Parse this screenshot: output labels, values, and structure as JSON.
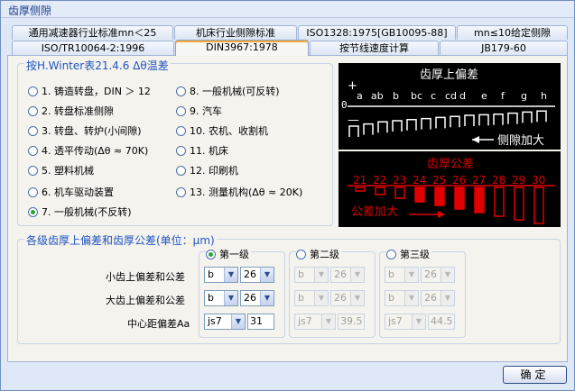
{
  "window": {
    "title": "齿厚侧隙"
  },
  "tabs_row1": [
    {
      "label": "通用减速器行业标准mn＜25"
    },
    {
      "label": "机床行业侧隙标准"
    },
    {
      "label": "ISO1328:1975[GB10095-88]"
    },
    {
      "label": "mn≤10给定侧隙"
    }
  ],
  "tabs_row2": [
    {
      "label": "ISO/TR10064-2:1996"
    },
    {
      "label": "DIN3967:1978"
    },
    {
      "label": "按节线速度计算"
    },
    {
      "label": "JB179-60"
    }
  ],
  "winter_group": {
    "title": "按H.Winter表21.4.6 Δθ温差",
    "options": [
      {
        "label": "1. 铸造转盘，DIN ＞ 12"
      },
      {
        "label": "2. 转盘标准侧隙"
      },
      {
        "label": "3. 转盘、转炉(小间隙)"
      },
      {
        "label": "4. 透平传动(Δθ ≈ 70K)"
      },
      {
        "label": "5. 塑料机械"
      },
      {
        "label": "6. 机车驱动装置"
      },
      {
        "label": "7. 一般机械(不反转)"
      },
      {
        "label": "8. 一般机械(可反转)"
      },
      {
        "label": "9. 汽车"
      },
      {
        "label": "10. 农机、收割机"
      },
      {
        "label": "11. 机床"
      },
      {
        "label": "12. 印刷机"
      },
      {
        "label": "13. 测量机构(Δθ ≈ 20K)"
      }
    ],
    "selected_index": 6
  },
  "diagram_upper": {
    "title": "齿厚上偏差",
    "plus": "+",
    "minus": "—",
    "zero": "0",
    "letters": [
      "a",
      "ab",
      "b",
      "bc",
      "c",
      "cd",
      "d",
      "e",
      "f",
      "g",
      "h"
    ],
    "arrow_label": "侧隙加大"
  },
  "diagram_lower": {
    "title": "齿厚公差",
    "numbers": [
      "21",
      "22",
      "23",
      "24",
      "25",
      "26",
      "27",
      "28",
      "29",
      "30"
    ],
    "arrow_label": "公差加大"
  },
  "grades_group": {
    "title": "各级齿厚上偏差和齿厚公差(单位：μm)",
    "grade_labels": [
      "第一级",
      "第二级",
      "第三级"
    ],
    "selected_grade": 0,
    "row_labels": [
      "小齿上偏差和公差",
      "大齿上偏差和公差",
      "中心距偏差Aa"
    ],
    "grade1": {
      "small_dev": "b",
      "small_tol": "26",
      "large_dev": "b",
      "large_tol": "26",
      "center_fit": "js7",
      "center_val": "31"
    },
    "grade2": {
      "small_dev": "b",
      "small_tol": "26",
      "large_dev": "b",
      "large_tol": "26",
      "center_fit": "js7",
      "center_val": "39.5"
    },
    "grade3": {
      "small_dev": "b",
      "small_tol": "26",
      "large_dev": "b",
      "large_tol": "26",
      "center_fit": "js7",
      "center_val": "44.5"
    }
  },
  "ok_button": {
    "label": "确定"
  },
  "colors": {
    "accent": "#1f54c0",
    "diagram_red": "#e00000",
    "radio_dot": "#2ea33a"
  }
}
